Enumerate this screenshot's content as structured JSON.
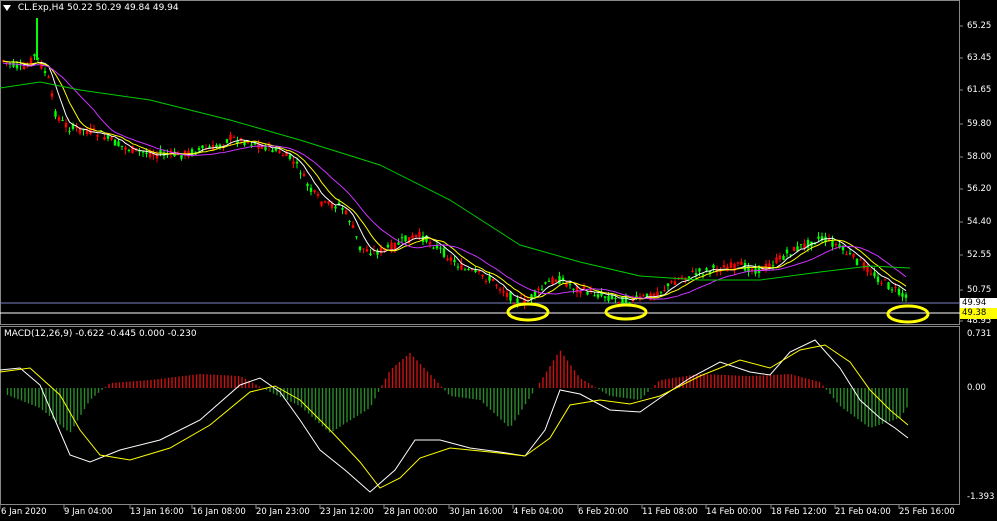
{
  "header": {
    "symbol_text": "CL.Exp,H4  50.22 50.29 49.84 49.94",
    "menu_icon": "triangle-down-icon"
  },
  "macd": {
    "label": "MACD(12,26,9) -0.622 -0.445 0.000 -0.230",
    "scale_top": "0.731",
    "scale_mid": "0.00",
    "scale_bottom": "-1.393"
  },
  "price_axis": {
    "labels": [
      "65.25",
      "63.45",
      "61.65",
      "59.80",
      "58.00",
      "56.20",
      "54.40",
      "52.55",
      "50.75",
      "48.95"
    ],
    "current_bid": "49.94",
    "line_level": "49.38"
  },
  "time_axis": {
    "labels": [
      "6 Jan 2020",
      "9 Jan 04:00",
      "13 Jan 16:00",
      "16 Jan 08:00",
      "20 Jan 23:00",
      "23 Jan 12:00",
      "28 Jan 00:00",
      "30 Jan 16:00",
      "4 Feb 04:00",
      "6 Feb 20:00",
      "11 Feb 08:00",
      "14 Feb 00:00",
      "18 Feb 12:00",
      "21 Feb 04:00",
      "25 Feb 16:00"
    ]
  },
  "colors": {
    "background": "#000000",
    "bull_candle": "#00ff00",
    "bear_candle": "#ff0000",
    "ma_fast": "#ffffff",
    "ma_mid": "#ffff00",
    "ma_slow": "#cc33ff",
    "ma_long": "#00cc00",
    "highlight": "#ffff00",
    "macd_line": "#ffffff",
    "signal_line": "#ffff00",
    "hist_pos": "#cc1111",
    "hist_neg": "#2b8a2b"
  },
  "highlights": [
    "support-ellipse-1",
    "support-ellipse-2",
    "support-ellipse-3"
  ]
}
